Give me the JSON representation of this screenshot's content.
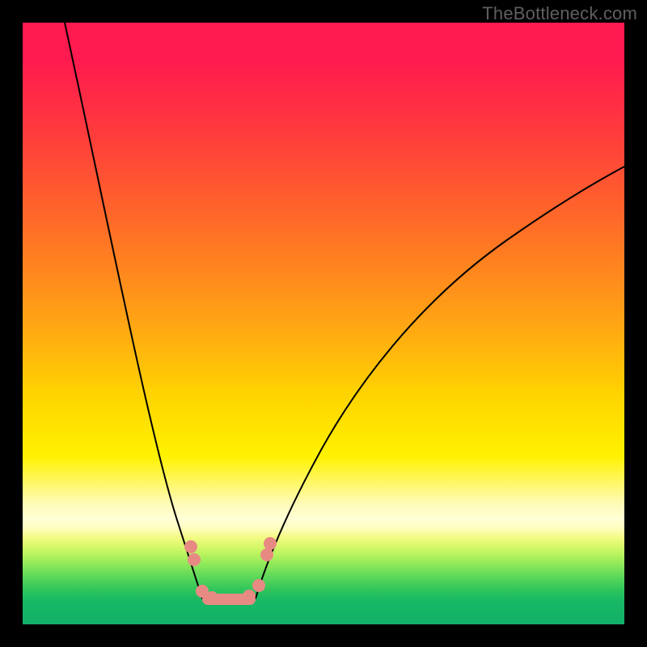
{
  "watermark": "TheBottleneck.com",
  "chart_data": {
    "type": "line",
    "title": "",
    "xlabel": "",
    "ylabel": "",
    "xlim": [
      0,
      100
    ],
    "ylim": [
      0,
      100
    ],
    "background_gradient": {
      "direction": "vertical",
      "stops": [
        {
          "pos": 0,
          "color": "#ff1a4f"
        },
        {
          "pos": 0.33,
          "color": "#ff6a28"
        },
        {
          "pos": 0.62,
          "color": "#ffd400"
        },
        {
          "pos": 0.82,
          "color": "#ffffd6"
        },
        {
          "pos": 1.0,
          "color": "#12b06a"
        }
      ]
    },
    "series": [
      {
        "name": "left-curve",
        "x": [
          7,
          12,
          17,
          22,
          25,
          27,
          28.5,
          29.8
        ],
        "y": [
          100,
          72,
          44,
          24,
          13,
          7,
          3,
          0.5
        ],
        "color": "#000000"
      },
      {
        "name": "right-curve",
        "x": [
          38.7,
          42,
          48,
          56,
          66,
          80,
          93,
          100
        ],
        "y": [
          0.5,
          7,
          18,
          33,
          48,
          62,
          72,
          76
        ],
        "color": "#000000"
      }
    ],
    "markers": {
      "color": "#e88a84",
      "points": [
        {
          "x": 27.9,
          "y": 12.9
        },
        {
          "x": 28.5,
          "y": 10.7
        },
        {
          "x": 29.8,
          "y": 5.5
        },
        {
          "x": 31.4,
          "y": 4.4
        },
        {
          "x": 37.6,
          "y": 4.7
        },
        {
          "x": 39.2,
          "y": 6.5
        },
        {
          "x": 40.6,
          "y": 11.6
        },
        {
          "x": 41.1,
          "y": 13.4
        }
      ],
      "bar": {
        "x_start": 29.8,
        "x_end": 38.7,
        "y": 4.0,
        "height": 1.9
      }
    }
  }
}
